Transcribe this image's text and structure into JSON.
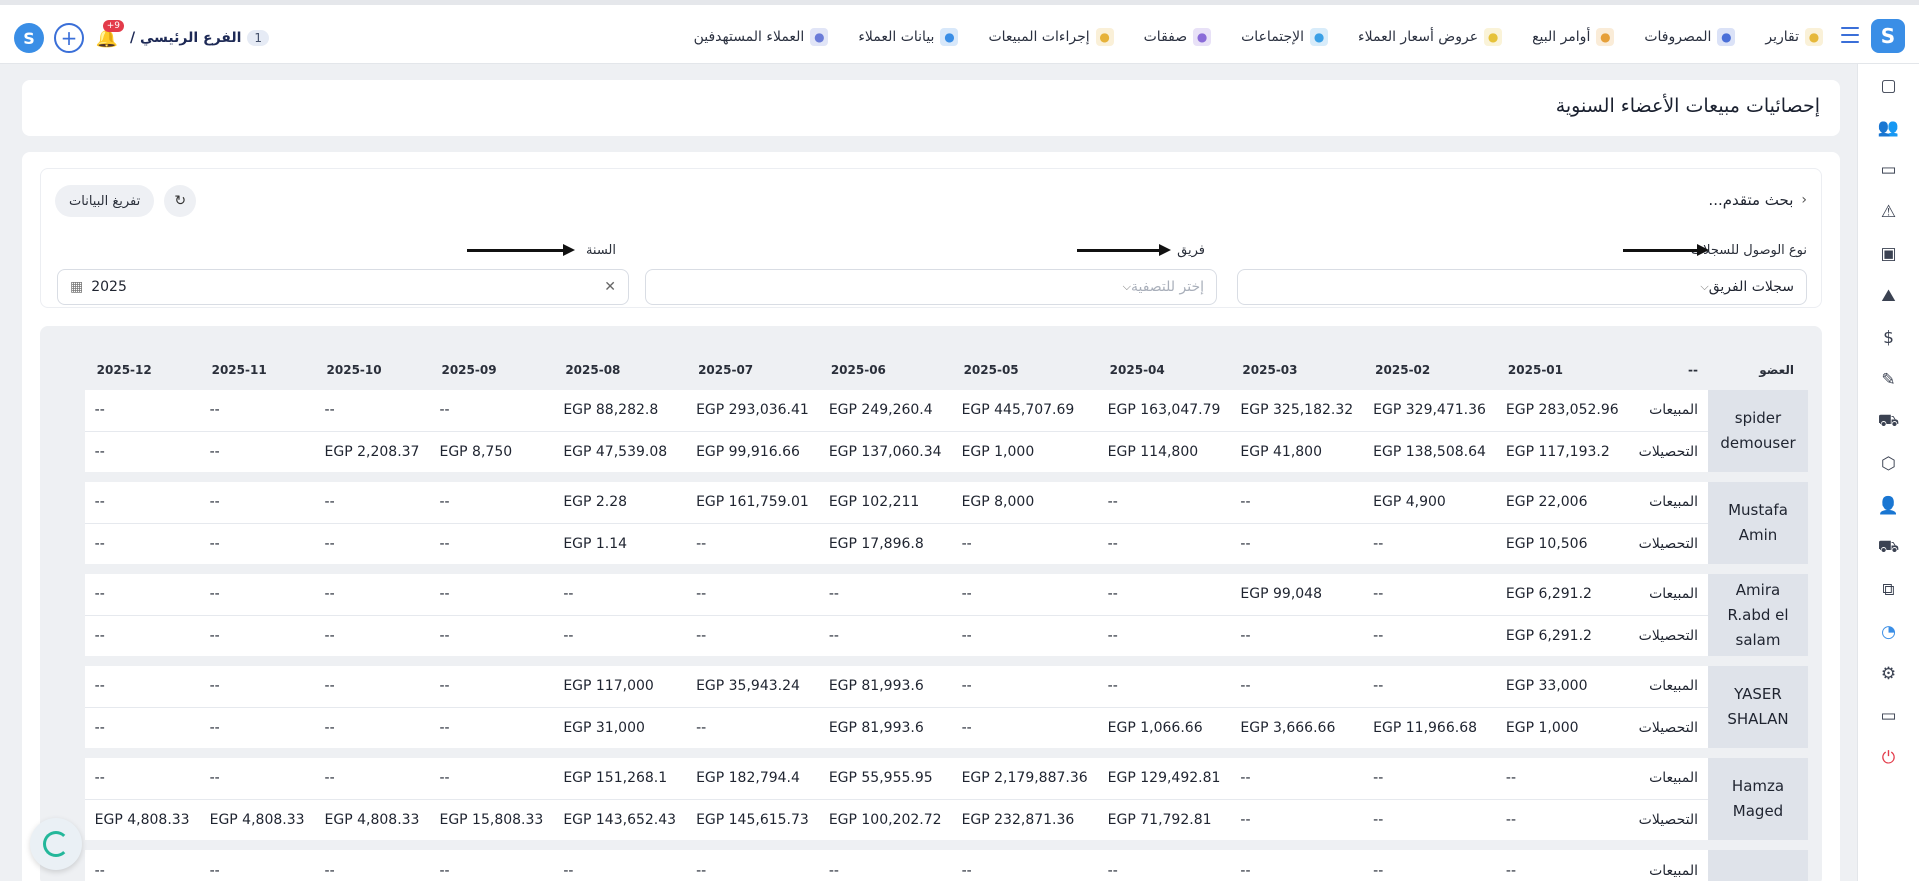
{
  "topbar": {
    "nav": [
      {
        "label": "العملاء المستهدفين",
        "icon": "target-customers-icon"
      },
      {
        "label": "بيانات العملاء",
        "icon": "customer-data-icon"
      },
      {
        "label": "إجراءات المبيعات",
        "icon": "sales-actions-icon"
      },
      {
        "label": "صفقات",
        "icon": "deals-icon"
      },
      {
        "label": "الإجتماعات",
        "icon": "meetings-icon"
      },
      {
        "label": "عروض أسعار العملاء",
        "icon": "quotes-icon"
      },
      {
        "label": "أوامر البيع",
        "icon": "sales-orders-icon"
      },
      {
        "label": "المصروفات",
        "icon": "expenses-icon"
      },
      {
        "label": "تقارير",
        "icon": "reports-icon"
      }
    ],
    "branch": {
      "label": "الفرع الرئيسي /",
      "number": "1"
    },
    "notifications_badge": "+9"
  },
  "page": {
    "title": "إحصائيات مبيعات الأعضاء السنوية"
  },
  "filters": {
    "advanced_search": "بحث متقدم...",
    "unload_button": "تفريغ البيانات",
    "access_type": {
      "label": "نوع الوصول للسجلات",
      "value": "سجلات الفريق"
    },
    "team": {
      "label": "فريق",
      "placeholder": "إختر للتصفية"
    },
    "year": {
      "label": "السنة",
      "value": "2025"
    }
  },
  "table": {
    "headers": {
      "member": "العضو",
      "kind": "--"
    },
    "months": [
      "2025-01",
      "2025-02",
      "2025-03",
      "2025-04",
      "2025-05",
      "2025-06",
      "2025-07",
      "2025-08",
      "2025-09",
      "2025-10",
      "2025-11",
      "2025-12"
    ],
    "members": [
      {
        "name": "spider demouser",
        "rows": [
          {
            "kind": "المبيعات",
            "values": [
              "EGP 283,052.96",
              "EGP 329,471.36",
              "EGP 325,182.32",
              "EGP 163,047.79",
              "EGP 445,707.69",
              "EGP 249,260.4",
              "EGP 293,036.41",
              "EGP 88,282.8",
              "--",
              "--",
              "--",
              "--"
            ]
          },
          {
            "kind": "التحصيلات",
            "values": [
              "EGP 117,193.2",
              "EGP 138,508.64",
              "EGP 41,800",
              "EGP 114,800",
              "EGP 1,000",
              "EGP 137,060.34",
              "EGP 99,916.66",
              "EGP 47,539.08",
              "EGP 8,750",
              "EGP 2,208.37",
              "--",
              "--"
            ]
          }
        ]
      },
      {
        "name": "Mustafa Amin",
        "rows": [
          {
            "kind": "المبيعات",
            "values": [
              "EGP 22,006",
              "EGP 4,900",
              "--",
              "--",
              "EGP 8,000",
              "EGP 102,211",
              "EGP 161,759.01",
              "EGP 2.28",
              "--",
              "--",
              "--",
              "--"
            ]
          },
          {
            "kind": "التحصيلات",
            "values": [
              "EGP 10,506",
              "--",
              "--",
              "--",
              "--",
              "EGP 17,896.8",
              "--",
              "EGP 1.14",
              "--",
              "--",
              "--",
              "--"
            ]
          }
        ]
      },
      {
        "name": "Amira R.abd el salam",
        "rows": [
          {
            "kind": "المبيعات",
            "values": [
              "EGP 6,291.2",
              "--",
              "EGP 99,048",
              "--",
              "--",
              "--",
              "--",
              "--",
              "--",
              "--",
              "--",
              "--"
            ]
          },
          {
            "kind": "التحصيلات",
            "values": [
              "EGP 6,291.2",
              "--",
              "--",
              "--",
              "--",
              "--",
              "--",
              "--",
              "--",
              "--",
              "--",
              "--"
            ]
          }
        ]
      },
      {
        "name": "YASER SHALAN",
        "rows": [
          {
            "kind": "المبيعات",
            "values": [
              "EGP 33,000",
              "--",
              "--",
              "--",
              "--",
              "EGP 81,993.6",
              "EGP 35,943.24",
              "EGP 117,000",
              "--",
              "--",
              "--",
              "--"
            ]
          },
          {
            "kind": "التحصيلات",
            "values": [
              "EGP 1,000",
              "EGP 11,966.68",
              "EGP 3,666.66",
              "EGP 1,066.66",
              "--",
              "EGP 81,993.6",
              "--",
              "EGP 31,000",
              "--",
              "--",
              "--",
              "--"
            ]
          }
        ]
      },
      {
        "name": "Hamza Maged",
        "rows": [
          {
            "kind": "المبيعات",
            "values": [
              "--",
              "--",
              "--",
              "EGP 129,492.81",
              "EGP 2,179,887.36",
              "EGP 55,955.95",
              "EGP 182,794.4",
              "EGP 151,268.1",
              "--",
              "--",
              "--",
              "--"
            ]
          },
          {
            "kind": "التحصيلات",
            "values": [
              "--",
              "--",
              "--",
              "EGP 71,792.81",
              "EGP 232,871.36",
              "EGP 100,202.72",
              "EGP 145,615.73",
              "EGP 143,652.43",
              "EGP 15,808.33",
              "EGP 4,808.33",
              "EGP 4,808.33",
              "EGP 4,808.33"
            ]
          }
        ]
      },
      {
        "name": "",
        "rows": [
          {
            "kind": "المبيعات",
            "values": [
              "--",
              "--",
              "--",
              "--",
              "--",
              "--",
              "--",
              "--",
              "--",
              "--",
              "--",
              "--"
            ]
          }
        ]
      }
    ]
  },
  "colors": {
    "accent": "#3a8ee6",
    "danger": "#e33b4a",
    "loader": "#23b79a"
  }
}
